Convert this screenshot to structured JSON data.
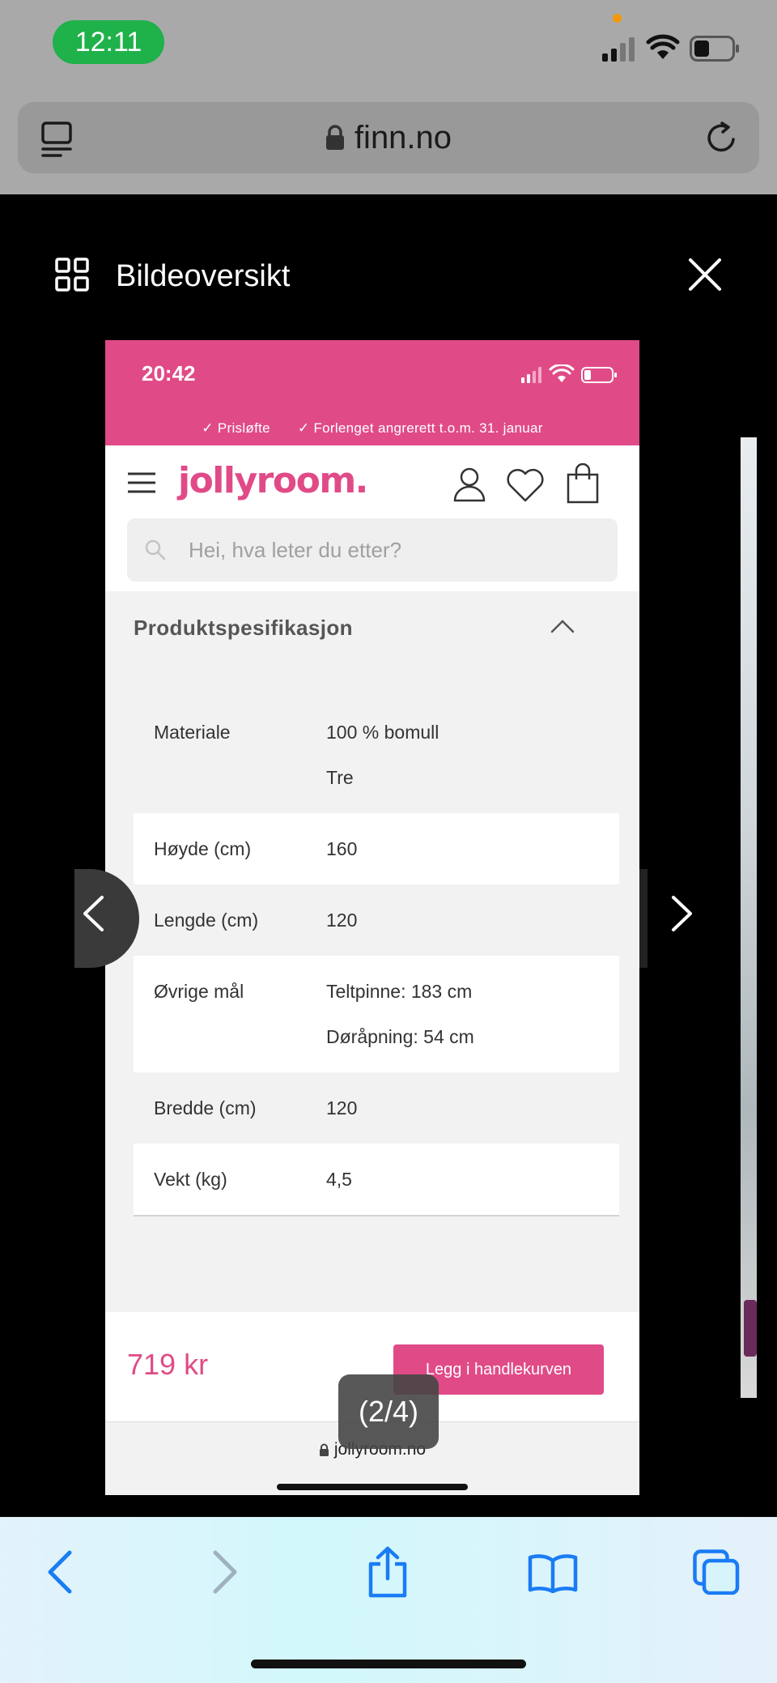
{
  "status_bar": {
    "time": "12:11"
  },
  "browser": {
    "url": "finn.no"
  },
  "viewer": {
    "title": "Bildeoversikt",
    "counter": "(2/4)"
  },
  "screenshot": {
    "status_time": "20:42",
    "promo_items": [
      "Prisløfte",
      "Forlenget angrerett t.o.m. 31. januar"
    ],
    "logo": "jollyroom.",
    "search_placeholder": "Hei, hva leter du etter?",
    "spec_heading": "Produktspesifikasjon",
    "specs": [
      {
        "label": "Materiale",
        "values": [
          "100 % bomull",
          "Tre"
        ]
      },
      {
        "label": "Høyde (cm)",
        "values": [
          "160"
        ]
      },
      {
        "label": "Lengde (cm)",
        "values": [
          "120"
        ]
      },
      {
        "label": "Øvrige mål",
        "values": [
          "Teltpinne: 183 cm",
          "Døråpning: 54 cm"
        ]
      },
      {
        "label": "Bredde (cm)",
        "values": [
          "120"
        ]
      },
      {
        "label": "Vekt (kg)",
        "values": [
          "4,5"
        ]
      }
    ],
    "price": "719 kr",
    "cart_button": "Legg i handlekurven",
    "url": "jollyroom.no"
  },
  "colors": {
    "brand_pink": "#e04b87",
    "status_green": "#1fb14a",
    "ios_blue": "#1a7cf5"
  },
  "icons": [
    "reader-icon",
    "lock-icon",
    "reload-icon",
    "grid-icon",
    "close-icon",
    "hamburger-icon",
    "user-icon",
    "heart-icon",
    "bag-icon",
    "search-icon",
    "chevron-up-icon",
    "back-icon",
    "forward-icon",
    "share-icon",
    "bookmarks-icon",
    "tabs-icon"
  ]
}
